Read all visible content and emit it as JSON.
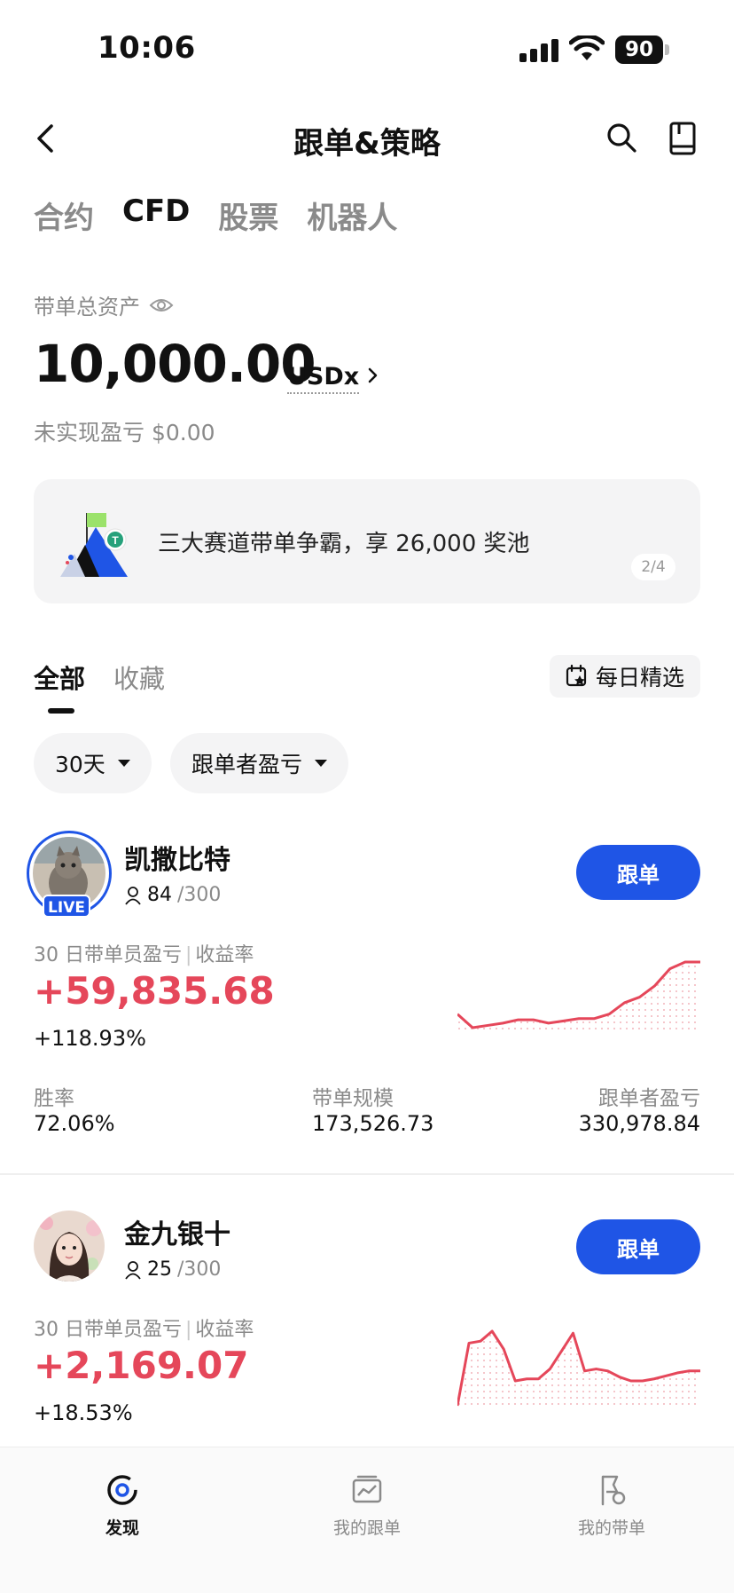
{
  "status_bar": {
    "time": "10:06",
    "battery": "90"
  },
  "nav": {
    "title": "跟单&策略"
  },
  "top_tabs": [
    {
      "label": "合约",
      "active": false
    },
    {
      "label": "CFD",
      "active": true
    },
    {
      "label": "股票",
      "active": false
    },
    {
      "label": "机器人",
      "active": false
    }
  ],
  "assets": {
    "label": "带单总资产",
    "value": "10,000.00",
    "unit": "USDx",
    "unrealized": "未实现盈亏 $0.00"
  },
  "banner": {
    "text": "三大赛道带单争霸，享 26,000 奖池",
    "page": "2/4"
  },
  "sub_tabs": [
    {
      "label": "全部",
      "active": true
    },
    {
      "label": "收藏",
      "active": false
    }
  ],
  "daily_pick": "每日精选",
  "filters": {
    "period": "30天",
    "sort": "跟单者盈亏"
  },
  "traders": [
    {
      "name": "凯撒比特",
      "live": "LIVE",
      "followers": "84",
      "followers_max": "/300",
      "follow_label": "跟单",
      "metric_label_a": "30 日带单员盈亏",
      "metric_label_b": "收益率",
      "pnl": "+59,835.68",
      "roi": "+118.93%",
      "stats": [
        {
          "label": "胜率",
          "value": "72.06%"
        },
        {
          "label": "带单规模",
          "value": "173,526.73"
        },
        {
          "label": "跟单者盈亏",
          "value": "330,978.84"
        }
      ],
      "spark": [
        30,
        18,
        20,
        22,
        25,
        25,
        22,
        24,
        26,
        26,
        30,
        40,
        45,
        55,
        70,
        76,
        76
      ]
    },
    {
      "name": "金九银十",
      "followers": "25",
      "followers_max": "/300",
      "follow_label": "跟单",
      "metric_label_a": "30 日带单员盈亏",
      "metric_label_b": "收益率",
      "pnl": "+2,169.07",
      "roi": "+18.53%",
      "spark": [
        5,
        68,
        70,
        80,
        62,
        30,
        32,
        32,
        42,
        60,
        78,
        40,
        42,
        40,
        34,
        30,
        30,
        32,
        35,
        38,
        40,
        40
      ]
    }
  ],
  "bottom_nav": [
    {
      "label": "发现",
      "active": true
    },
    {
      "label": "我的跟单",
      "active": false
    },
    {
      "label": "我的带单",
      "active": false
    }
  ],
  "colors": {
    "accent": "#1f55e6",
    "profit": "#e5475a"
  }
}
